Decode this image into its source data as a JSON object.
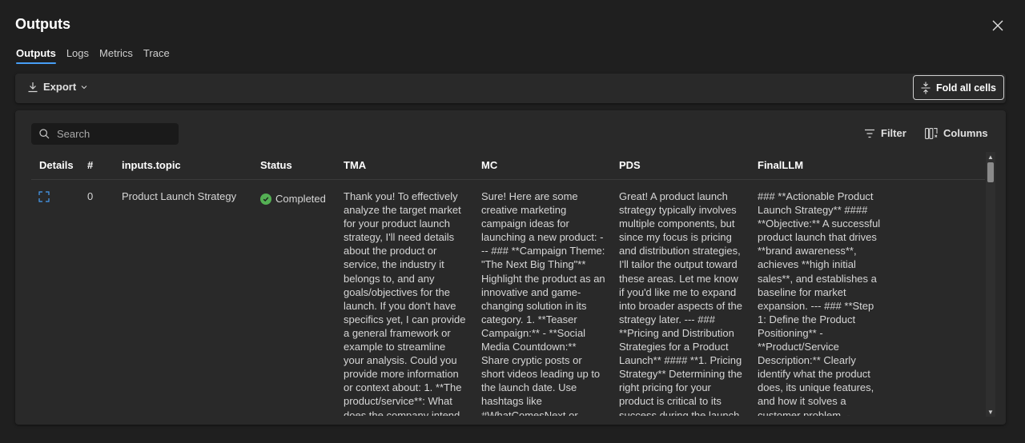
{
  "window": {
    "title": "Outputs"
  },
  "tabs": [
    {
      "label": "Outputs"
    },
    {
      "label": "Logs"
    },
    {
      "label": "Metrics"
    },
    {
      "label": "Trace"
    }
  ],
  "toolbar": {
    "export_label": "Export",
    "fold_label": "Fold all cells"
  },
  "search": {
    "placeholder": "Search"
  },
  "filter_label": "Filter",
  "columns_label": "Columns",
  "table": {
    "headers": [
      "Details",
      "#",
      "inputs.topic",
      "Status",
      "TMA",
      "MC",
      "PDS",
      "FinalLLM"
    ],
    "rows": [
      {
        "index": "0",
        "topic": "Product Launch Strategy",
        "status": "Completed",
        "tma": "Thank you! To effectively analyze the target market for your product launch strategy, I'll need details about the product or service, the industry it belongs to, and any goals/objectives for the launch. If you don't have specifics yet, I can provide a general framework or example to streamline your analysis. Could you provide more information or context about: 1. **The product/service**: What does the company intend to sell? What problem does it solve?",
        "mc": "Sure! Here are some creative marketing campaign ideas for launching a new product: --- ### **Campaign Theme: \"The Next Big Thing\"** Highlight the product as an innovative and game-changing solution in its category. 1. **Teaser Campaign:** - **Social Media Countdown:** Share cryptic posts or short videos leading up to the launch date. Use hashtags like #WhatComesNext or #TheNextBigThing. - **Mysterious Package**",
        "pds": "Great! A product launch strategy typically involves multiple components, but since my focus is pricing and distribution strategies, I'll tailor the output toward these areas. Let me know if you'd like me to expand into broader aspects of the strategy later. --- ### **Pricing and Distribution Strategies for a Product Launch** #### **1. Pricing Strategy** Determining the right pricing for your product is critical to its success during the launch",
        "finalllm": "### **Actionable Product Launch Strategy** #### **Objective:** A successful product launch that drives **brand awareness**, achieves **high initial sales**, and establishes a baseline for market expansion. --- ### **Step 1: Define the Product Positioning** - **Product/Service Description:** Clearly identify what the product does, its unique features, and how it solves a customer problem. - **Value"
      }
    ]
  },
  "colors": {
    "background": "#1f1f1f",
    "surface": "#292929",
    "accent": "#479ef5",
    "success": "#54b054"
  }
}
